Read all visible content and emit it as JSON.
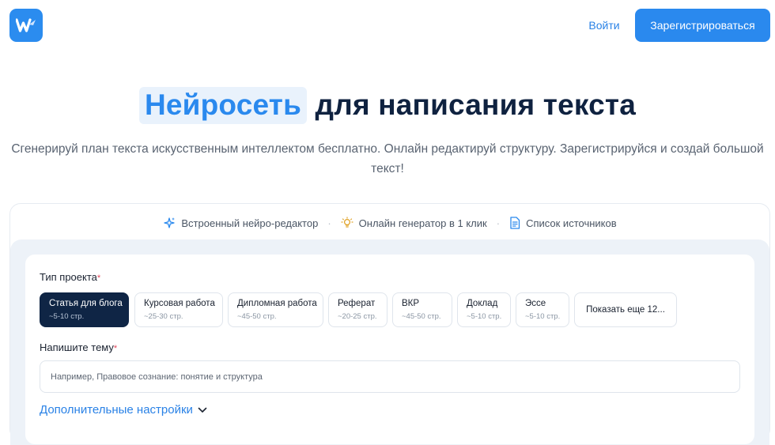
{
  "header": {
    "logo_letter": "W",
    "login_label": "Войти",
    "register_label": "Зарегистрироваться"
  },
  "hero": {
    "title_highlight": "Нейросеть",
    "title_rest": "для написания текста",
    "subtitle": "Сгенерируй план текста искусственным интеллектом бесплатно. Онлайн редактируй структуру. Зарегистрируйся и создай большой текст!"
  },
  "features": [
    {
      "icon": "sparkles-icon",
      "label": "Встроенный нейро-редактор"
    },
    {
      "icon": "lightbulb-icon",
      "label": "Онлайн генератор в 1 клик"
    },
    {
      "icon": "document-icon",
      "label": "Список источников"
    }
  ],
  "form": {
    "project_type_label": "Тип проекта",
    "required_mark": "*",
    "project_types": [
      {
        "title": "Статья для блога",
        "pages": "~5-10 стр.",
        "selected": true
      },
      {
        "title": "Курсовая работа",
        "pages": "~25-30 стр.",
        "selected": false
      },
      {
        "title": "Дипломная работа",
        "pages": "~45-50 стр.",
        "selected": false
      },
      {
        "title": "Реферат",
        "pages": "~20-25 стр.",
        "selected": false
      },
      {
        "title": "ВКР",
        "pages": "~45-50 стр.",
        "selected": false
      },
      {
        "title": "Доклад",
        "pages": "~5-10 стр.",
        "selected": false
      },
      {
        "title": "Эссе",
        "pages": "~5-10 стр.",
        "selected": false
      }
    ],
    "show_more_label": "Показать еще 12...",
    "topic_label": "Напишите тему",
    "topic_value": "",
    "topic_placeholder": "Например, Правовое сознание: понятие и структура",
    "advanced_label": "Дополнительные настройки"
  },
  "colors": {
    "accent": "#2a89ee",
    "dark_chip": "#0f2545",
    "title": "#0f2240",
    "required": "#e2465a"
  }
}
